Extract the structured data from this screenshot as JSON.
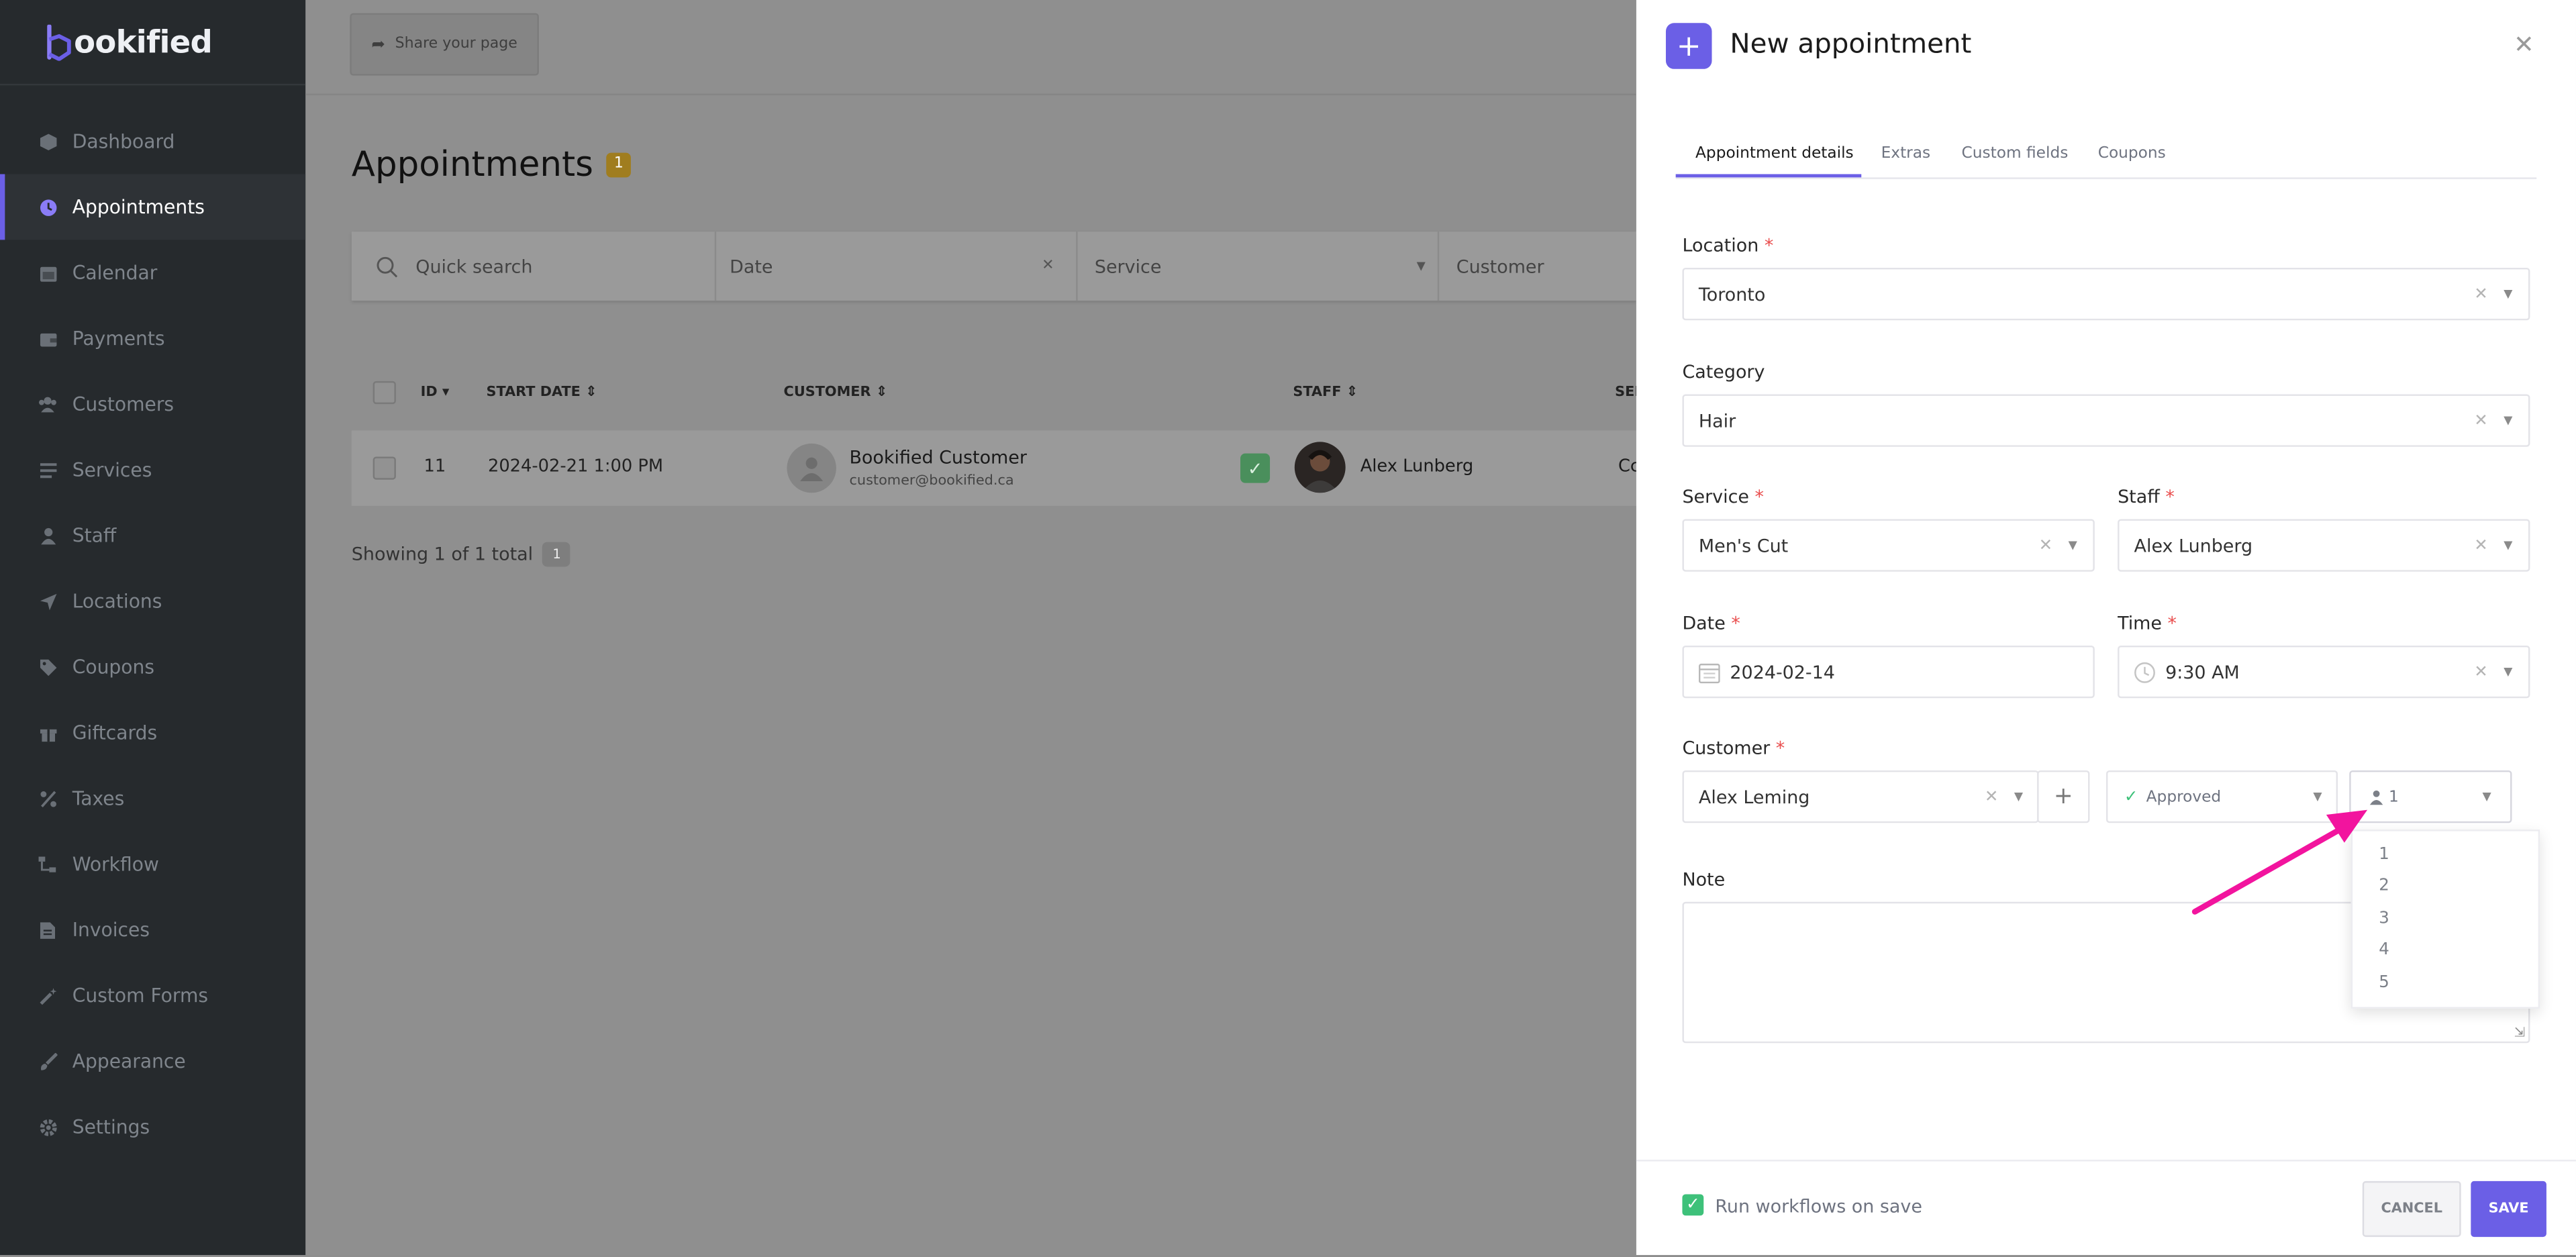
{
  "brand": {
    "name": "ookified",
    "accent": "#6b5fe6"
  },
  "sidebar": {
    "items": [
      {
        "label": "Dashboard",
        "icon": "cube-icon"
      },
      {
        "label": "Appointments",
        "icon": "clock-icon",
        "active": true
      },
      {
        "label": "Calendar",
        "icon": "calendar-icon"
      },
      {
        "label": "Payments",
        "icon": "wallet-icon"
      },
      {
        "label": "Customers",
        "icon": "users-icon"
      },
      {
        "label": "Services",
        "icon": "list-icon"
      },
      {
        "label": "Staff",
        "icon": "user-icon"
      },
      {
        "label": "Locations",
        "icon": "location-arrow-icon"
      },
      {
        "label": "Coupons",
        "icon": "tag-icon"
      },
      {
        "label": "Giftcards",
        "icon": "gift-icon"
      },
      {
        "label": "Taxes",
        "icon": "percent-icon"
      },
      {
        "label": "Workflow",
        "icon": "workflow-icon"
      },
      {
        "label": "Invoices",
        "icon": "file-icon"
      },
      {
        "label": "Custom Forms",
        "icon": "magic-wand-icon"
      },
      {
        "label": "Appearance",
        "icon": "brush-icon"
      },
      {
        "label": "Settings",
        "icon": "gear-icon"
      }
    ]
  },
  "main": {
    "share_label": "Share your page",
    "title": "Appointments",
    "title_count": "1",
    "filters": {
      "search_placeholder": "Quick search",
      "date_placeholder": "Date",
      "service_placeholder": "Service",
      "customer_placeholder": "Customer"
    },
    "columns": {
      "id": "ID",
      "start_date": "START DATE",
      "customer": "CUSTOMER",
      "staff": "STAFF",
      "service": "SEF"
    },
    "rows": [
      {
        "id": "11",
        "start_date": "2024-02-21 1:00 PM",
        "customer_name": "Bookified Customer",
        "customer_email": "customer@bookified.ca",
        "staff": "Alex Lunberg",
        "service": "Cc"
      }
    ],
    "showing_text": "Showing 1 of 1 total",
    "showing_page": "1"
  },
  "panel": {
    "title": "New appointment",
    "tabs": [
      "Appointment details",
      "Extras",
      "Custom fields",
      "Coupons"
    ],
    "location_label": "Location",
    "location_value": "Toronto",
    "category_label": "Category",
    "category_value": "Hair",
    "service_label": "Service",
    "service_value": "Men's Cut",
    "staff_label": "Staff",
    "staff_value": "Alex Lunberg",
    "date_label": "Date",
    "date_value": "2024-02-14",
    "time_label": "Time",
    "time_value": "9:30 AM",
    "customer_label": "Customer",
    "customer_value": "Alex Leming",
    "status_value": "Approved",
    "persons_value": "1",
    "persons_options": [
      "1",
      "2",
      "3",
      "4",
      "5"
    ],
    "note_label": "Note",
    "required_mark": "*",
    "run_workflows_label": "Run workflows on save",
    "run_workflows_checked": true,
    "cancel_label": "CANCEL",
    "save_label": "SAVE"
  },
  "annotation": {
    "arrow_color": "#f2149e"
  }
}
